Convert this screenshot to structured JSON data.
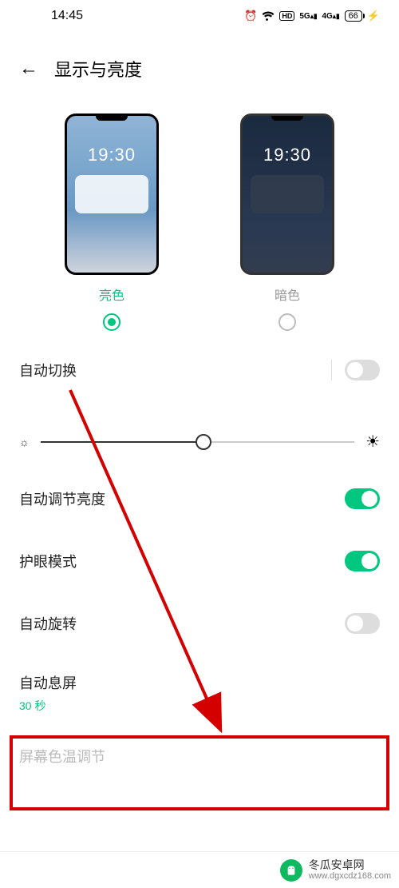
{
  "status": {
    "time": "14:45",
    "battery": "66"
  },
  "header": {
    "title": "显示与亮度"
  },
  "theme": {
    "preview_time": "19:30",
    "light_label": "亮色",
    "dark_label": "暗色"
  },
  "settings": {
    "auto_switch": "自动切换",
    "auto_brightness": "自动调节亮度",
    "eye_comfort": "护眼模式",
    "auto_rotate": "自动旋转",
    "auto_screen_off": "自动息屏",
    "auto_screen_off_value": "30 秒",
    "color_temp": "屏幕色温调节"
  },
  "footer": {
    "brand": "冬瓜安卓网",
    "url": "www.dgxcdz168.com"
  }
}
